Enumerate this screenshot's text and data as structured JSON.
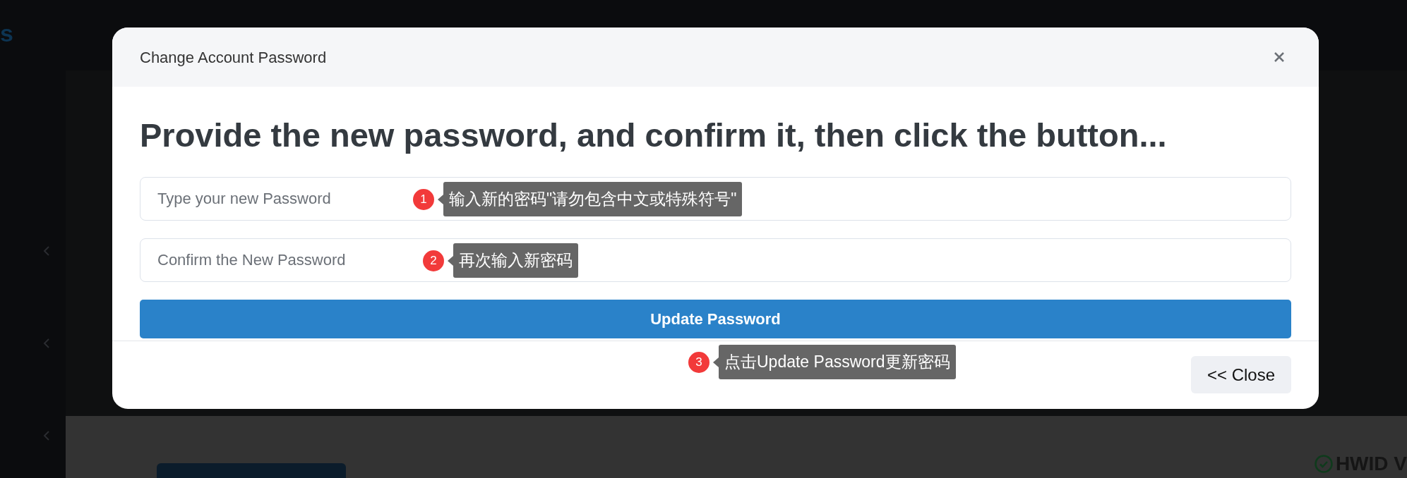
{
  "background": {
    "brand_text": "s",
    "hwid_status": "HWID V"
  },
  "modal": {
    "title": "Change Account Password",
    "heading": "Provide the new password, and confirm it, then click the button...",
    "fields": [
      {
        "placeholder": "Type your new Password"
      },
      {
        "placeholder": "Confirm the New Password"
      }
    ],
    "submit_button": "Update Password",
    "close_button": "<< Close"
  },
  "annotations": [
    {
      "number": "1",
      "text": "输入新的密码\"请勿包含中文或特殊符号\""
    },
    {
      "number": "2",
      "text": "再次输入新密码"
    },
    {
      "number": "3",
      "text": "点击Update Password更新密码"
    }
  ]
}
